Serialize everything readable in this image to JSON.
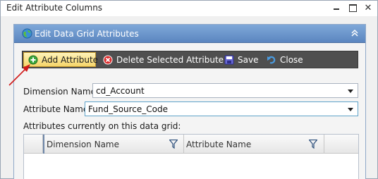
{
  "window": {
    "title": "Edit Attribute Columns"
  },
  "panel": {
    "title": "Edit Data Grid Attributes"
  },
  "toolbar": {
    "add_label": "Add Attribute",
    "delete_label": "Delete Selected Attribute",
    "save_label": "Save",
    "close_label": "Close"
  },
  "form": {
    "dimension_label": "Dimension Name",
    "dimension_value": "cd_Account",
    "attribute_label": "Attribute Name",
    "attribute_value": "Fund_Source_Code",
    "grid_caption": "Attributes currently on this data grid:"
  },
  "grid": {
    "columns": [
      "Dimension Name",
      "Attribute Name"
    ]
  },
  "colors": {
    "panel_header": "#6b96cc",
    "toolbar_bg": "#4f4f4f",
    "add_button": "#f6d56a",
    "arrow": "#d11a1a"
  },
  "icons": [
    "globe-icon",
    "collapse-icon",
    "add-icon",
    "delete-icon",
    "save-icon",
    "close-undo-icon",
    "filter-icon"
  ]
}
